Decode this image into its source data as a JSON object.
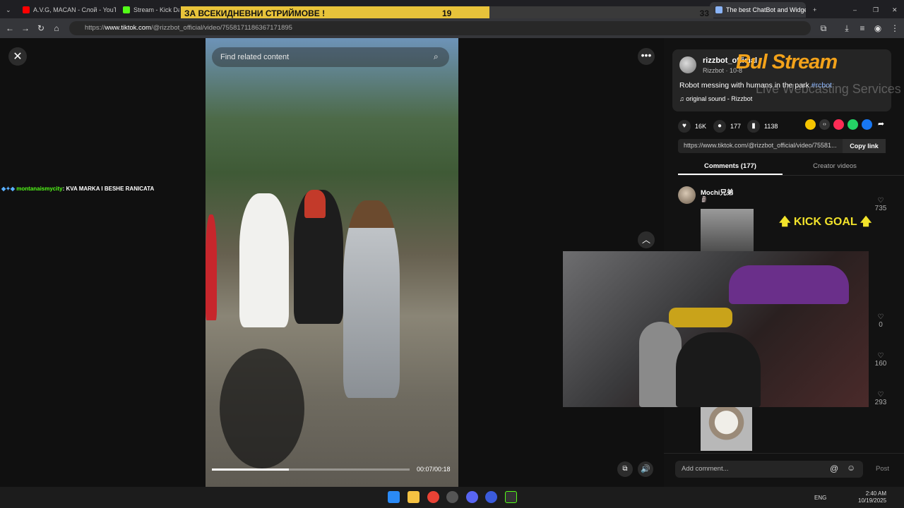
{
  "browser": {
    "tabs": [
      {
        "title": "A.V.G, MACAN - Слой - YouT",
        "color": "#ff0000"
      },
      {
        "title": "Stream - Kick Dashbo",
        "color": "#53fc18"
      },
      {
        "title": "The best ChatBot and Widge",
        "color": "#8ab4f8"
      }
    ],
    "url_prefix": "https://",
    "url_host": "www.tiktok.com",
    "url_path": "/@rizzbot_official/video/7558171186367171895"
  },
  "overlay": {
    "goal_text": "ЗА ВСЕКИДНЕВНИ СТРИЙМОВЕ !",
    "goal_current": "19",
    "goal_target": "33",
    "goal_fraction": 0.58,
    "logo_text": "Bul  Stream",
    "logo_tagline": "Live Webcasting Services",
    "kick_goal": "🡅 KICK GOAL 🡅",
    "chat_user": "montanaismycity",
    "chat_message": ": KVA MARKA I BESHE RANICATA"
  },
  "video": {
    "search_placeholder": "Find related content",
    "time_readout": "00:07/00:18",
    "progress_fraction": 0.39
  },
  "panel": {
    "author_name": "rizzbot_official",
    "author_sub": "Rizzbot · 10-8",
    "description": "Robot messing with humans in the park ",
    "hashtag": "#rcbot",
    "sound": "♫  original sound - Rizzbot",
    "likes": "16K",
    "comments_count": "177",
    "saves": "1138",
    "link": "https://www.tiktok.com/@rizzbot_official/video/75581...",
    "copy_link": "Copy link",
    "tab_comments": "Comments (177)",
    "tab_creator": "Creator videos",
    "comment_author": "Mochi兄弟",
    "comment_emoji": "🗿",
    "comment_likes": [
      "735",
      "0",
      "160",
      "293"
    ],
    "comment_placeholder": "Add comment...",
    "post": "Post"
  },
  "taskbar": {
    "lang": "ENG",
    "time": "2:40 AM",
    "date": "10/19/2025"
  },
  "colors": {
    "accent": "#53fc18",
    "goal": "#e8c33a",
    "kick_goal": "#f2e32b"
  }
}
